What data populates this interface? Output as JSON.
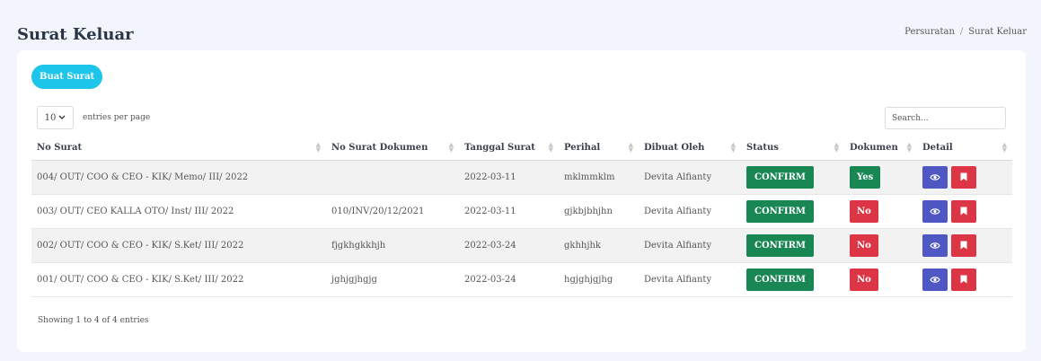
{
  "header": {
    "title": "Surat Keluar",
    "breadcrumb": [
      "Persuratan",
      "Surat Keluar"
    ],
    "breadcrumb_sep": "/"
  },
  "toolbar": {
    "create_label": "Buat Surat",
    "per_page_value": "10",
    "per_page_label": "entries per page",
    "search_placeholder": "Search..."
  },
  "table": {
    "columns": [
      "No Surat",
      "No Surat Dokumen",
      "Tanggal Surat",
      "Perihal",
      "Dibuat Oleh",
      "Status",
      "Dokumen",
      "Detail"
    ],
    "rows": [
      {
        "no_surat": "004/ OUT/ COO & CEO - KIK/ Memo/ III/ 2022",
        "no_dokumen": "",
        "tanggal": "2022-03-11",
        "perihal": "mklmmklm",
        "dibuat_oleh": "Devita Alfianty",
        "status": "CONFIRM",
        "dokumen": "Yes"
      },
      {
        "no_surat": "003/ OUT/ CEO KALLA OTO/ Inst/ III/ 2022",
        "no_dokumen": "010/INV/20/12/2021",
        "tanggal": "2022-03-11",
        "perihal": "gjkbjbhjhn",
        "dibuat_oleh": "Devita Alfianty",
        "status": "CONFIRM",
        "dokumen": "No"
      },
      {
        "no_surat": "002/ OUT/ COO & CEO - KIK/ S.Ket/ III/ 2022",
        "no_dokumen": "fjgkhgkkhjh",
        "tanggal": "2022-03-24",
        "perihal": "gkhhjhk",
        "dibuat_oleh": "Devita Alfianty",
        "status": "CONFIRM",
        "dokumen": "No"
      },
      {
        "no_surat": "001/ OUT/ COO & CEO - KIK/ S.Ket/ III/ 2022",
        "no_dokumen": "jghjgjhgjg",
        "tanggal": "2022-03-24",
        "perihal": "hgjghjgjhg",
        "dibuat_oleh": "Devita Alfianty",
        "status": "CONFIRM",
        "dokumen": "No"
      }
    ]
  },
  "footer": {
    "info": "Showing 1 to 4 of 4 entries"
  },
  "colors": {
    "primary": "#1ec5ea",
    "success": "#198754",
    "danger": "#dc3545",
    "view": "#4e57c4"
  },
  "icons": {
    "view": "eye-icon",
    "bookmark": "bookmark-icon",
    "dropdown": "chevron-down-icon",
    "sort": "sort-icon"
  }
}
